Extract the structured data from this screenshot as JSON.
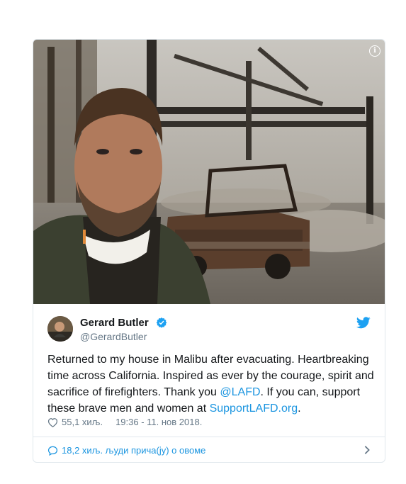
{
  "tweet": {
    "author_name": "Gerard Butler",
    "author_handle": "@GerardButler",
    "text_before": "Returned to my house in Malibu after evacuating. Heartbreaking time across California. Inspired as ever by the courage, spirit and sacrifice of firefighters. Thank you ",
    "mention": "@LAFD",
    "text_middle": ". If you can, support these brave men and women at ",
    "link": "SupportLAFD.org",
    "text_after": ".",
    "likes": "55,1 хиљ.",
    "timestamp": "19:36 - 11. нов 2018.",
    "replies_summary": "18,2 хиљ. људи прича(ју) о овоме",
    "info_glyph": "i"
  },
  "colors": {
    "link": "#1b95e0",
    "verified": "#1da1f2",
    "secondary_text": "#657786",
    "border": "#e1e8ed"
  },
  "icons": [
    "info-icon",
    "verified-badge-icon",
    "twitter-bird-icon",
    "heart-icon",
    "reply-bubble-icon",
    "chevron-right-icon"
  ]
}
